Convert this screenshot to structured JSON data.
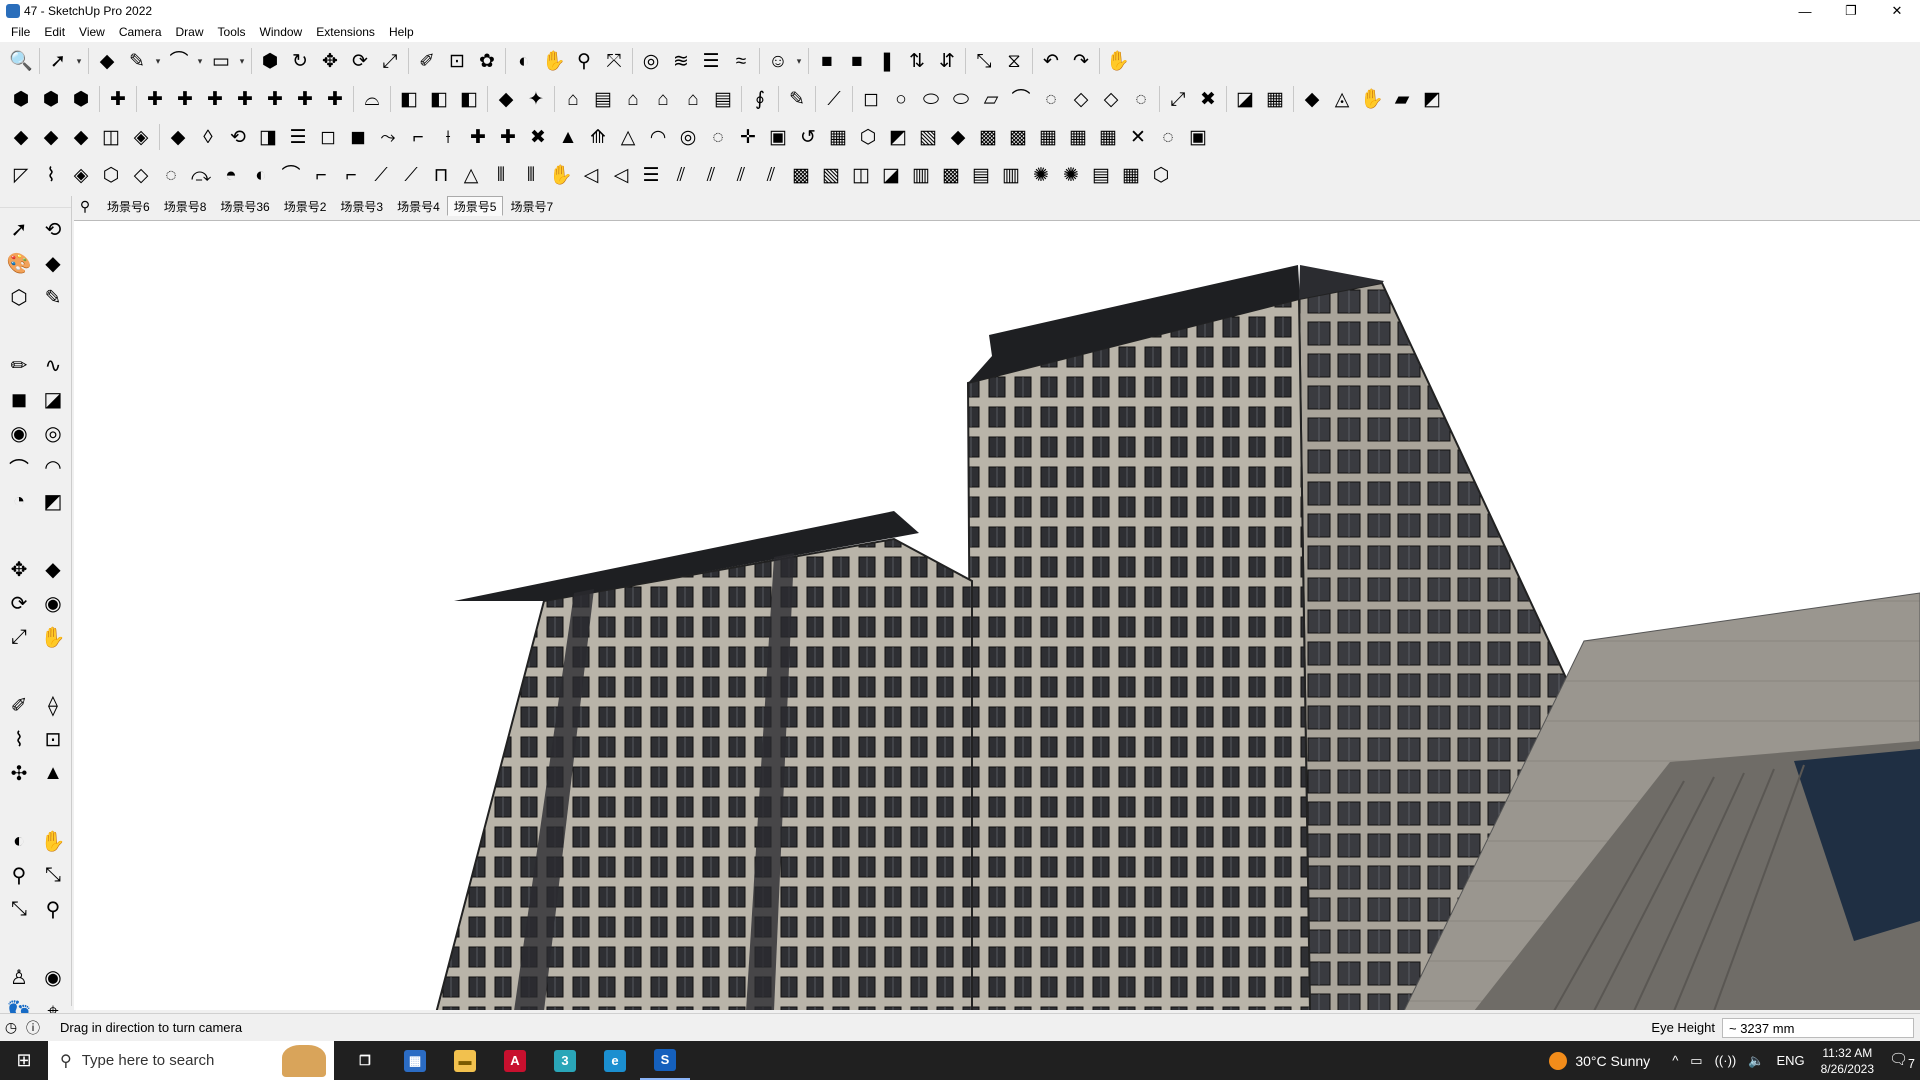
{
  "window": {
    "title": "47 - SketchUp Pro 2022",
    "controls": [
      "—",
      "❐",
      "✕"
    ]
  },
  "menu": [
    "File",
    "Edit",
    "View",
    "Camera",
    "Draw",
    "Tools",
    "Window",
    "Extensions",
    "Help"
  ],
  "toolbars": {
    "row1": [
      "🔍",
      "|",
      "➚",
      "▾",
      "|",
      "◆",
      "✎",
      "▾",
      "⌒",
      "▾",
      "▭",
      "▾",
      "|",
      "⬢",
      "↻",
      "✥",
      "⟳",
      "⤢",
      "|",
      "✐",
      "⊡",
      "✿",
      "|",
      "◐",
      "✋",
      "⚲",
      "⤧",
      "|",
      "◎",
      "≋",
      "☰",
      "≈",
      "|",
      "☺",
      "▾",
      "|",
      "■",
      "■",
      "❚",
      "⇅",
      "⇵",
      "|",
      "⤡",
      "⧖",
      "|",
      "↶",
      "↷",
      "|",
      "✋"
    ],
    "row2": [
      "⬢",
      "⬢",
      "⬢",
      "|",
      "✚",
      "|",
      "✚",
      "✚",
      "✚",
      "✚",
      "✚",
      "✚",
      "✚",
      "|",
      "⌓",
      "|",
      "◧",
      "◧",
      "◧",
      "|",
      "◆",
      "✦",
      "|",
      "⌂",
      "▤",
      "⌂",
      "⌂",
      "⌂",
      "▤",
      "|",
      "∮",
      "|",
      "✎",
      "|",
      "⟋",
      "|",
      "◻",
      "○",
      "⬭",
      "⬭",
      "▱",
      "⌒",
      "◌",
      "◇",
      "◇",
      "◌",
      "|",
      "⤢",
      "✖",
      "|",
      "◪",
      "▦",
      "|",
      "◆",
      "◬",
      "✋",
      "▰",
      "◩"
    ],
    "row3": [
      "◆",
      "◆",
      "◆",
      "◫",
      "◈",
      "|",
      "◆",
      "◊",
      "⟲",
      "◨",
      "☰",
      "◻",
      "◼",
      "⤳",
      "⌐",
      "⟊",
      "✚",
      "✚",
      "✖",
      "▲",
      "⟰",
      "△",
      "◠",
      "◎",
      "◌",
      "✛",
      "▣",
      "↺",
      "▦",
      "⬡",
      "◩",
      "▧",
      "◆",
      "▩",
      "▩",
      "▦",
      "▦",
      "▦",
      "✕",
      "◌",
      "▣"
    ],
    "row4": [
      "◸",
      "⌇",
      "◈",
      "⬡",
      "◇",
      "◌",
      "⤼",
      "◓",
      "◐",
      "⌒",
      "⌐",
      "⌐",
      "⟋",
      "⟋",
      "⊓",
      "△",
      "⫴",
      "⫴",
      "✋",
      "◁",
      "◁",
      "☰",
      "⫽",
      "⫽",
      "⫽",
      "⫽",
      "▩",
      "▧",
      "◫",
      "◪",
      "▥",
      "▩",
      "▤",
      "▥",
      "✺",
      "✺",
      "▤",
      "▦",
      "⬡"
    ]
  },
  "scenes": {
    "search_glyph": "⚲",
    "tabs": [
      "场景号6",
      "场景号8",
      "场景号36",
      "场景号2",
      "场景号3",
      "场景号4",
      "场景号5",
      "场景号7"
    ],
    "active_index": 6
  },
  "left_tools": [
    "➚",
    "⟲",
    "🎨",
    "◆",
    "⬡",
    "✎",
    "|",
    "✏",
    "∿",
    "◼",
    "◪",
    "◉",
    "◎",
    "⌒",
    "◠",
    "◔",
    "◩",
    "|",
    "✥",
    "◆",
    "⟳",
    "◉",
    "⤢",
    "✋",
    "|",
    "✐",
    "⟠",
    "⌇",
    "⊡",
    "✣",
    "▲",
    "|",
    "◐",
    "✋",
    "⚲",
    "⤡",
    "⤡",
    "⚲",
    "|",
    "♙",
    "◉",
    "👣",
    "⌖",
    "|",
    "◎",
    "≋",
    "☰",
    "≈"
  ],
  "status": {
    "icon1": "◷",
    "icon2": "ⓘ",
    "message": "Drag in direction to turn camera",
    "measurement_label": "Eye Height",
    "measurement_value": "~ 3237 mm"
  },
  "taskbar": {
    "start_glyph": "⊞",
    "search_glyph": "⚲",
    "search_placeholder": "Type here to search",
    "apps": [
      {
        "name": "task-view",
        "glyph": "❐",
        "bg": "#202020",
        "fg": "#ffffff"
      },
      {
        "name": "calculator",
        "glyph": "▦",
        "bg": "#2b6cc4",
        "fg": "#ffffff"
      },
      {
        "name": "file-explorer",
        "glyph": "▬",
        "bg": "#f2c14e",
        "fg": "#7a5a00"
      },
      {
        "name": "autocad",
        "glyph": "A",
        "bg": "#c8102e",
        "fg": "#ffffff"
      },
      {
        "name": "3dsmax",
        "glyph": "3",
        "bg": "#2aa6b8",
        "fg": "#ffffff"
      },
      {
        "name": "edge",
        "glyph": "e",
        "bg": "#1b8fd0",
        "fg": "#ffffff"
      },
      {
        "name": "sketchup",
        "glyph": "S",
        "bg": "#1560bd",
        "fg": "#ffffff"
      }
    ],
    "active_app_index": 6,
    "weather": "30°C  Sunny",
    "tray_icons": [
      "^",
      "▭",
      "((·))",
      "🔈"
    ],
    "language": "ENG",
    "time": "11:32 AM",
    "date": "8/26/2023",
    "notification_glyph": "🗨",
    "notification_count": "7"
  }
}
